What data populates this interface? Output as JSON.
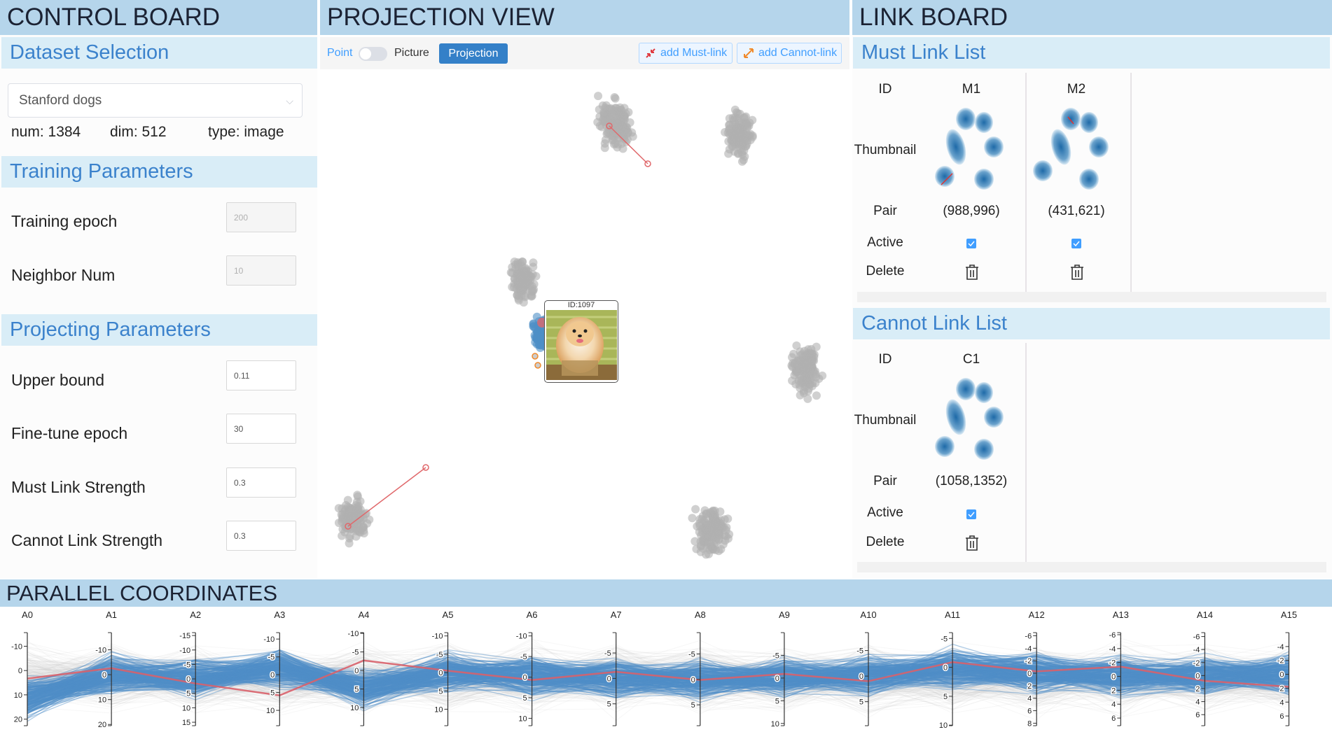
{
  "control_board": {
    "title": "CONTROL BOARD",
    "dataset": {
      "header": "Dataset Selection",
      "selected": "Stanford dogs",
      "num": "num: 1384",
      "dim": "dim: 512",
      "type": "type: image"
    },
    "training": {
      "header": "Training Parameters",
      "fields": [
        {
          "label": "Training epoch",
          "value": "200",
          "disabled": true
        },
        {
          "label": "Neighbor Num",
          "value": "10",
          "disabled": true
        }
      ]
    },
    "projecting": {
      "header": "Projecting Parameters",
      "fields": [
        {
          "label": "Upper bound",
          "value": "0.11"
        },
        {
          "label": "Fine-tune epoch",
          "value": "30"
        },
        {
          "label": "Must Link Strength",
          "value": "0.3"
        },
        {
          "label": "Cannot Link Strength",
          "value": "0.3"
        }
      ]
    }
  },
  "projection_view": {
    "title": "PROJECTION VIEW",
    "toolbar": {
      "point_label": "Point",
      "toggle_on": false,
      "picture_label": "Picture",
      "projection_button": "Projection",
      "add_must_link": "add Must-link",
      "add_cannot_link": "add Cannot-link"
    },
    "tooltip": {
      "id_label": "ID:1097"
    },
    "colors": {
      "default_point": "#b0b0b0",
      "selected_cluster": "#4f8fc7",
      "must_link": "#e0686b",
      "cannot_link_marker": "#f08a2c"
    }
  },
  "link_board": {
    "title": "LINK BOARD",
    "row_labels": {
      "id": "ID",
      "thumbnail": "Thumbnail",
      "pair": "Pair",
      "active": "Active",
      "delete": "Delete"
    },
    "must_link": {
      "header": "Must Link List",
      "items": [
        {
          "id": "M1",
          "pair": "(988,996)",
          "active": true
        },
        {
          "id": "M2",
          "pair": "(431,621)",
          "active": true
        }
      ]
    },
    "cannot_link": {
      "header": "Cannot Link List",
      "items": [
        {
          "id": "C1",
          "pair": "(1058,1352)",
          "active": true
        }
      ]
    }
  },
  "parallel_coordinates": {
    "title": "PARALLEL COORDINATES",
    "chart_data": {
      "type": "parallel",
      "axes": [
        {
          "name": "A0",
          "range": [
            -15.6,
            22.7
          ],
          "ticks": [
            -10,
            0,
            10,
            20
          ]
        },
        {
          "name": "A1",
          "range": [
            -16.9,
            20.5
          ],
          "ticks": [
            -10,
            0,
            10,
            20
          ]
        },
        {
          "name": "A2",
          "range": [
            -16,
            16.2
          ],
          "ticks": [
            -15,
            -10,
            -5,
            0,
            5,
            10,
            15
          ]
        },
        {
          "name": "A3",
          "range": [
            -11.8,
            14.3
          ],
          "ticks": [
            -10,
            -5,
            0,
            5,
            10
          ]
        },
        {
          "name": "A4",
          "range": [
            -10.2,
            14.9
          ],
          "ticks": [
            -10,
            -5,
            0,
            5,
            10
          ]
        },
        {
          "name": "A5",
          "range": [
            -10.9,
            14.5
          ],
          "ticks": [
            -10,
            -5,
            0,
            5,
            10
          ]
        },
        {
          "name": "A6",
          "range": [
            -10.8,
            11.8
          ],
          "ticks": [
            -10,
            -5,
            0,
            5,
            10
          ]
        },
        {
          "name": "A7",
          "range": [
            -9,
            9.3
          ],
          "ticks": [
            -5,
            0,
            5
          ]
        },
        {
          "name": "A8",
          "range": [
            -9.2,
            9.1
          ],
          "ticks": [
            -5,
            0,
            5
          ]
        },
        {
          "name": "A9",
          "range": [
            -10,
            10.5
          ],
          "ticks": [
            -5,
            0,
            5,
            10
          ]
        },
        {
          "name": "A10",
          "range": [
            -8.5,
            9.7
          ],
          "ticks": [
            -5,
            0,
            5
          ]
        },
        {
          "name": "A11",
          "range": [
            -6,
            10.1
          ],
          "ticks": [
            -5,
            0,
            5,
            10
          ]
        },
        {
          "name": "A12",
          "range": [
            -6.5,
            8.4
          ],
          "ticks": [
            -6,
            -4,
            -2,
            0,
            2,
            4,
            6,
            8
          ]
        },
        {
          "name": "A13",
          "range": [
            -6.3,
            7.1
          ],
          "ticks": [
            -6,
            -4,
            -2,
            0,
            2,
            4,
            6
          ]
        },
        {
          "name": "A14",
          "range": [
            -6.6,
            7.7
          ],
          "ticks": [
            -6,
            -4,
            -2,
            0,
            2,
            4,
            6
          ]
        },
        {
          "name": "A15",
          "range": [
            -6,
            7.4
          ],
          "ticks": [
            -4,
            -2,
            0,
            2,
            4,
            6
          ]
        }
      ],
      "highlighted_line": [
        3.3,
        -2.6,
        1.6,
        5.8,
        -2.7,
        -0.5,
        0.7,
        -1.3,
        0.1,
        -0.9,
        1.0,
        -0.9,
        -0.3,
        -1.4,
        0.8,
        1.8
      ],
      "colors": {
        "background_lines": "#d3d3d3",
        "selected_lines": "#4f8fc7",
        "highlighted_line": "#d9606a"
      }
    }
  }
}
